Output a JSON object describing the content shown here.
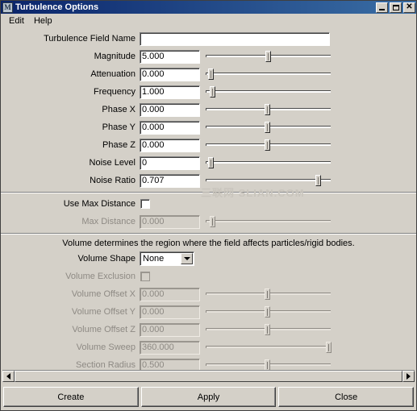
{
  "window": {
    "title": "Turbulence Options",
    "icon": "maya-icon",
    "controls": {
      "minimize": "minimize-icon",
      "maximize": "maximize-icon",
      "close": "close-icon"
    }
  },
  "menubar": {
    "items": [
      {
        "label": "Edit"
      },
      {
        "label": "Help"
      }
    ]
  },
  "watermark": "三联网 SLIAN.COM",
  "form": {
    "name_row": {
      "label": "Turbulence Field Name",
      "value": "",
      "placeholder": ""
    },
    "attributes": [
      {
        "label": "Magnitude",
        "value": "5.000",
        "slider": 48,
        "disabled": false
      },
      {
        "label": "Attenuation",
        "value": "0.000",
        "slider": 2,
        "disabled": false
      },
      {
        "label": "Frequency",
        "value": "1.000",
        "slider": 3,
        "disabled": false
      },
      {
        "label": "Phase X",
        "value": "0.000",
        "slider": 47,
        "disabled": false
      },
      {
        "label": "Phase Y",
        "value": "0.000",
        "slider": 47,
        "disabled": false
      },
      {
        "label": "Phase Z",
        "value": "0.000",
        "slider": 47,
        "disabled": false
      },
      {
        "label": "Noise Level",
        "value": "0",
        "slider": 2,
        "disabled": false
      },
      {
        "label": "Noise Ratio",
        "value": "0.707",
        "slider": 88,
        "disabled": false
      }
    ],
    "max_distance_section": {
      "checkbox_label": "Use Max Distance",
      "checked": false,
      "row": {
        "label": "Max Distance",
        "value": "0.000",
        "slider": 3,
        "disabled": true
      }
    },
    "volume_section": {
      "note": "Volume determines the region where the field affects particles/rigid bodies.",
      "shape_label": "Volume Shape",
      "shape_value": "None",
      "shape_options": [
        "None"
      ],
      "exclusion_label": "Volume Exclusion",
      "exclusion_checked": false,
      "rows": [
        {
          "label": "Volume Offset X",
          "value": "0.000",
          "slider": 47,
          "disabled": true
        },
        {
          "label": "Volume Offset Y",
          "value": "0.000",
          "slider": 47,
          "disabled": true
        },
        {
          "label": "Volume Offset Z",
          "value": "0.000",
          "slider": 47,
          "disabled": true
        },
        {
          "label": "Volume Sweep",
          "value": "360.000",
          "slider": 96,
          "disabled": true
        },
        {
          "label": "Section Radius",
          "value": "0.500",
          "slider": 47,
          "disabled": true
        }
      ]
    }
  },
  "scrollbar": {
    "left_arrow": "scroll-left-icon",
    "right_arrow": "scroll-right-icon",
    "thumb_percent": 95
  },
  "buttons": [
    {
      "label": "Create"
    },
    {
      "label": "Apply"
    },
    {
      "label": "Close"
    }
  ]
}
